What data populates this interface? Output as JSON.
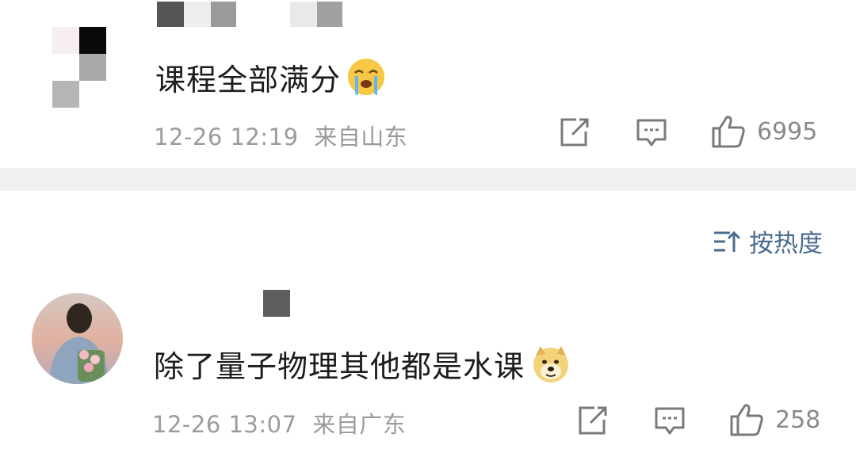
{
  "comments": [
    {
      "text": "课程全部满分",
      "emoji": "crying-face-emoji",
      "time": "12-26 12:19",
      "location": "来自山东",
      "likes": "6995",
      "username_redacted": true
    },
    {
      "text": "除了量子物理其他都是水课",
      "emoji": "doge-emoji",
      "time": "12-26 13:07",
      "location": "来自广东",
      "likes": "258",
      "username_redacted": true
    }
  ],
  "sort": {
    "label": "按热度",
    "icon": "sort-icon"
  },
  "colors": {
    "meta_gray": "#9b9b9b",
    "divider": "#f1f1f1",
    "sort_blue": "#4b6b8f"
  },
  "icons": [
    "share-icon",
    "comment-icon",
    "like-icon"
  ]
}
